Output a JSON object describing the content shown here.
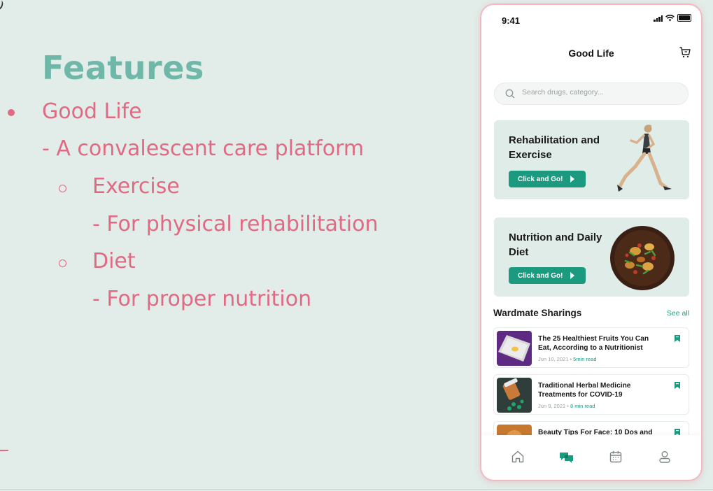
{
  "slide": {
    "title": "Features",
    "bullets": [
      {
        "text": "Good Life"
      },
      {
        "text": "- A convalescent care platform"
      },
      {
        "text": "Exercise"
      },
      {
        "text": "- For physical rehabilitation"
      },
      {
        "text": "Diet"
      },
      {
        "text": "- For proper nutrition"
      }
    ]
  },
  "phone": {
    "status_time": "9:41",
    "app_title": "Good Life",
    "search_placeholder": "Search drugs, category...",
    "cards": [
      {
        "title": "Rehabilitation and Exercise",
        "button": "Click and Go!"
      },
      {
        "title": "Nutrition and Daily Diet",
        "button": "Click and Go!"
      }
    ],
    "section_title": "Wardmate Sharings",
    "see_all": "See all",
    "articles": [
      {
        "title": "The 25 Healthiest Fruits You Can Eat, According to a Nutritionist",
        "date": "Jun 10, 2021",
        "read": "5min read"
      },
      {
        "title": "Traditional Herbal Medicine Treatments for COVID-19",
        "date": "Jun 9, 2021",
        "read": "8 min read"
      },
      {
        "title": "Beauty Tips For Face: 10 Dos and",
        "date": "",
        "read": ""
      }
    ],
    "tabs": [
      "home-icon",
      "chat-icon",
      "calendar-icon",
      "profile-icon"
    ],
    "active_tab": "chat-icon"
  },
  "colors": {
    "background": "#e2ece8",
    "title": "#6fb7a8",
    "bullet": "#e06a83",
    "accent": "#1c9a80",
    "card": "#e0ece8"
  }
}
